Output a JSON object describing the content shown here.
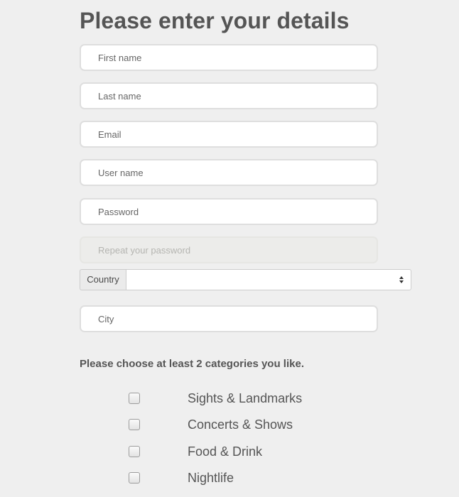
{
  "form": {
    "title": "Please enter your details",
    "fields": {
      "first_name": {
        "placeholder": "First name",
        "value": ""
      },
      "last_name": {
        "placeholder": "Last name",
        "value": ""
      },
      "email": {
        "placeholder": "Email",
        "value": ""
      },
      "user_name": {
        "placeholder": "User name",
        "value": ""
      },
      "password": {
        "placeholder": "Password",
        "value": ""
      },
      "repeat_password": {
        "placeholder": "Repeat your password",
        "value": "",
        "disabled": true
      },
      "city": {
        "placeholder": "City",
        "value": ""
      }
    },
    "country": {
      "label": "Country",
      "selected": ""
    },
    "categories": {
      "prompt": "Please choose at least 2 categories you like.",
      "items": [
        {
          "label": "Sights & Landmarks",
          "checked": false
        },
        {
          "label": "Concerts & Shows",
          "checked": false
        },
        {
          "label": "Food & Drink",
          "checked": false
        },
        {
          "label": "Nightlife",
          "checked": false
        }
      ]
    }
  },
  "colors": {
    "background": "#efefef",
    "text": "#555555",
    "field_border": "#dedede",
    "disabled_background": "#ececea"
  },
  "icons": {
    "country_select": "select-arrows-icon"
  }
}
